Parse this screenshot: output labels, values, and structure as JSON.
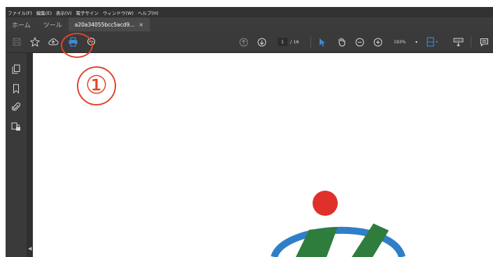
{
  "menu": [
    "ファイル(F)",
    "編集(E)",
    "表示(V)",
    "電子サイン",
    "ウィンドウ(W)",
    "ヘルプ(H)"
  ],
  "tabs": [
    {
      "label": "ホーム",
      "active": false
    },
    {
      "label": "ツール",
      "active": false
    },
    {
      "label": "a20a34055bcc5acd9...",
      "active": true,
      "close": "×"
    }
  ],
  "toolbar": {
    "icons_left": [
      "save-icon",
      "star-icon",
      "upload-cloud-icon",
      "print-icon",
      "search-zoom-icon"
    ],
    "page_current": "1",
    "page_total": "/ 16",
    "zoom": "193%",
    "zoom_caret": "▾",
    "icons_right": [
      "page-up-icon",
      "page-down-icon",
      "cursor-icon",
      "hand-icon",
      "zoom-out-icon",
      "zoom-in-icon",
      "fit-page-icon",
      "keyboard-icon",
      "comment-icon"
    ]
  },
  "sidebar": {
    "icons": [
      "pages-icon",
      "bookmark-icon",
      "attachment-icon",
      "lock-icon"
    ]
  },
  "annotation": {
    "number": "①",
    "color": "#e0442a"
  },
  "colors": {
    "dark_ui": "#323232",
    "toolbar": "#3a3a3a",
    "accent_blue": "#3f8ad8",
    "logo_red": "#e0302a",
    "logo_green": "#2e7d3c",
    "logo_blue": "#2f7fc8"
  }
}
